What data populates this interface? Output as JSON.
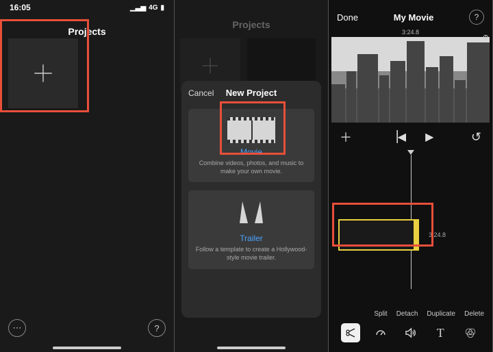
{
  "panel1": {
    "time": "16:05",
    "network": "4G",
    "title": "Projects",
    "more_btn": "⋯",
    "help_btn": "?"
  },
  "panel2": {
    "title_faded": "Projects",
    "sheet": {
      "cancel": "Cancel",
      "title": "New Project",
      "movie": {
        "label": "Movie",
        "desc": "Combine videos, photos, and music to make your own movie."
      },
      "trailer": {
        "label": "Trailer",
        "desc": "Follow a template to create a Hollywood-style movie trailer."
      }
    }
  },
  "panel3": {
    "done": "Done",
    "title": "My Movie",
    "help": "?",
    "time_total": "3:24.8",
    "clip_time": "3:24.8",
    "actions": {
      "split": "Split",
      "detach": "Detach",
      "duplicate": "Duplicate",
      "delete": "Delete"
    },
    "tools": {
      "scissors": "✂",
      "speed": "◔",
      "volume": "🔊",
      "text": "T",
      "filter": "⬤"
    }
  }
}
